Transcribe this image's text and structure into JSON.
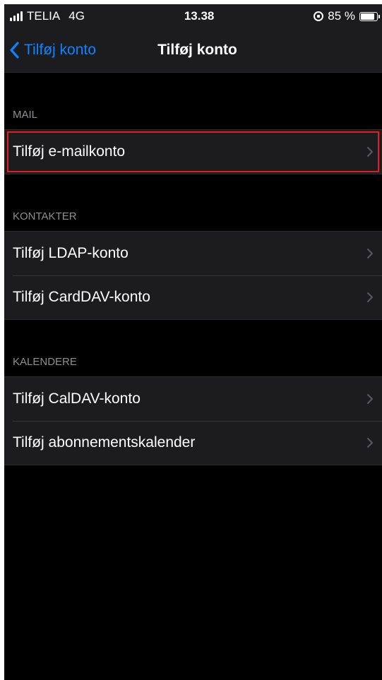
{
  "status_bar": {
    "carrier": "TELIA",
    "network": "4G",
    "time": "13.38",
    "battery_text": "85 %",
    "battery_level": 0.85
  },
  "nav": {
    "back_label": "Tilføj konto",
    "title": "Tilføj konto"
  },
  "sections": [
    {
      "header": "MAIL",
      "items": [
        {
          "label": "Tilføj e-mailkonto",
          "highlighted": true
        }
      ]
    },
    {
      "header": "KONTAKTER",
      "items": [
        {
          "label": "Tilføj LDAP-konto"
        },
        {
          "label": "Tilføj CardDAV-konto"
        }
      ]
    },
    {
      "header": "KALENDERE",
      "items": [
        {
          "label": "Tilføj CalDAV-konto"
        },
        {
          "label": "Tilføj abonnementskalender"
        }
      ]
    }
  ],
  "colors": {
    "accent": "#0a84ff",
    "highlight_border": "#e02020",
    "background": "#000000",
    "cell_background": "#1c1c1e",
    "section_header_text": "#8e8e93"
  },
  "icons": {
    "back": "chevron-left-icon",
    "disclosure": "chevron-right-icon",
    "signal": "signal-bars-icon",
    "orientation_lock": "orientation-lock-icon",
    "battery": "battery-icon"
  }
}
